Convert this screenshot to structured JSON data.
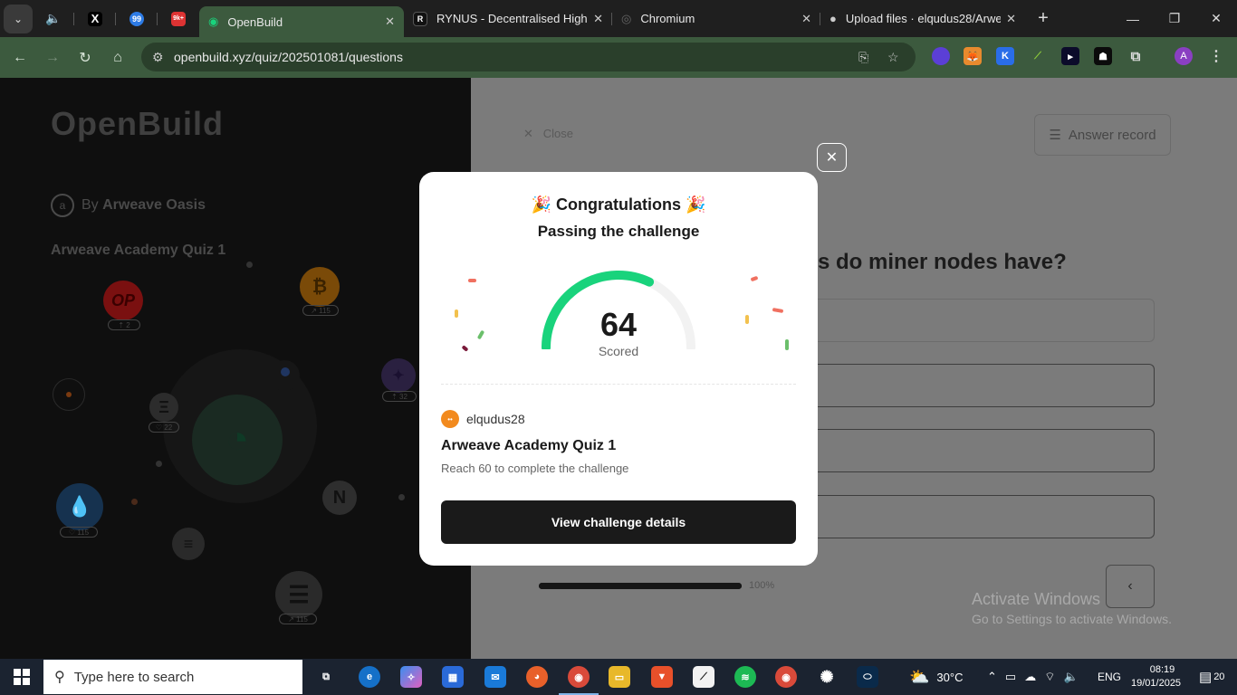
{
  "browser": {
    "pinned_tabs": [
      {
        "name": "audio-tab",
        "icon": "speaker-icon"
      },
      {
        "name": "x-tab",
        "label": "X"
      },
      {
        "name": "99-tab",
        "label": "99"
      },
      {
        "name": "notif-tab",
        "badge": "9k+"
      }
    ],
    "tabs": [
      {
        "title": "OpenBuild",
        "active": true
      },
      {
        "title": "RYNUS - Decentralised High-E",
        "active": false
      },
      {
        "title": "Chromium",
        "active": false
      },
      {
        "title": "Upload files · elqudus28/Arwe",
        "active": false
      }
    ],
    "url": "openbuild.xyz/quiz/202501081/questions",
    "profile_initial": "A",
    "colors": {
      "frame": "#1f1f1f",
      "toolbar": "#3c5a3e",
      "omnibox": "#2a3f2b"
    }
  },
  "left": {
    "logo": "OpenBuild",
    "by_prefix": "By",
    "by_name": "Arweave Oasis",
    "quiz_title": "Arweave Academy Quiz 1",
    "orbs": {
      "op": {
        "label": "OP",
        "badge": "⇡ 2"
      },
      "btc": {
        "label": "₿",
        "badge": "↗ 115"
      },
      "eth": {
        "label": "Ξ",
        "badge": "♡ 22"
      },
      "arb": {
        "badge": "⇡ 32"
      },
      "sui": {
        "badge": "♡ 115"
      },
      "near": {
        "label": "N"
      },
      "sol": {
        "label": "≡"
      },
      "ena": {
        "badge": "↗ 115"
      }
    }
  },
  "right": {
    "close_label": "Close",
    "answer_record_label": "Answer record",
    "question_fragment": "s do miner nodes have?",
    "progress_value": 1.0,
    "progress_label": "100%",
    "watermark_title": "Activate Windows",
    "watermark_sub": "Go to Settings to activate Windows."
  },
  "modal": {
    "title": "Congratulations",
    "subtitle": "Passing the challenge",
    "score": "64",
    "score_label": "Scored",
    "score_max": 100,
    "username": "elqudus28",
    "quiz_name": "Arweave Academy Quiz 1",
    "requirement": "Reach 60 to complete the challenge",
    "button_label": "View challenge details",
    "accent_color": "#19d37c"
  },
  "taskbar": {
    "search_placeholder": "Type here to search",
    "weather": "30°C",
    "language": "ENG",
    "time": "08:19",
    "date": "19/01/2025",
    "notifications": "20"
  }
}
